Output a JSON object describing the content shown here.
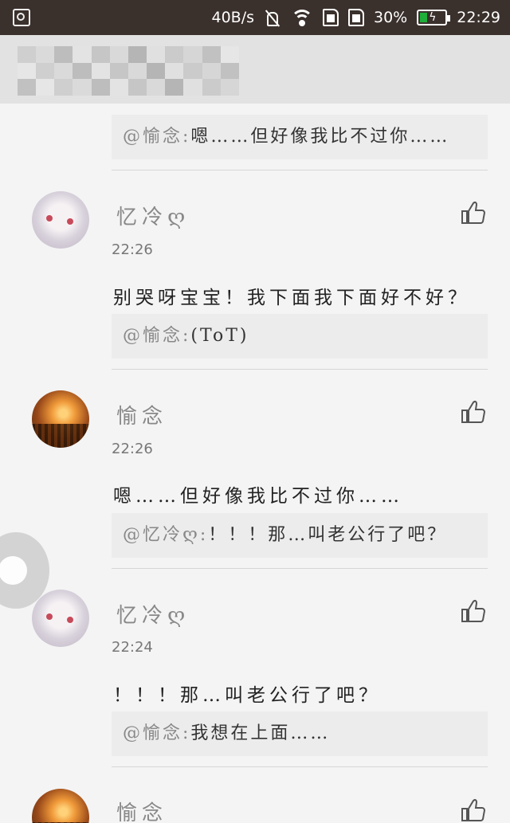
{
  "status_bar": {
    "speed": "40B/s",
    "battery_percent": "30%",
    "battery_level": 0.3,
    "time": "22:29"
  },
  "comments": [
    {
      "user": "",
      "time": "",
      "text": "",
      "reply": {
        "mention": "@愉念:",
        "text": "嗯……但好像我比不过你……"
      }
    },
    {
      "user": "忆冷ღ",
      "time": "22:26",
      "text": "别哭呀宝宝！我下面我下面好不好？",
      "reply": {
        "mention": "@愉念:",
        "text": "(ToT)"
      }
    },
    {
      "user": "愉念",
      "time": "22:26",
      "text": "嗯……但好像我比不过你……",
      "reply": {
        "mention": "@忆冷ღ:",
        "text": "！！！那…叫老公行了吧？"
      }
    },
    {
      "user": "忆冷ღ",
      "time": "22:24",
      "text": "！！！那…叫老公行了吧？",
      "reply": {
        "mention": "@愉念:",
        "text": "我想在上面……"
      }
    },
    {
      "user": "愉念",
      "time": "",
      "text": "",
      "reply": null
    }
  ],
  "icons": {
    "like": "thumbs-up-icon",
    "mute": "mute-icon",
    "wifi": "wifi-icon",
    "battery": "battery-icon",
    "image": "image-icon"
  },
  "colors": {
    "status_bar": "#3a302c",
    "battery_fill": "#1fae3a",
    "background": "#f4f4f4",
    "reply_bg": "#ececec",
    "username": "#888888"
  }
}
